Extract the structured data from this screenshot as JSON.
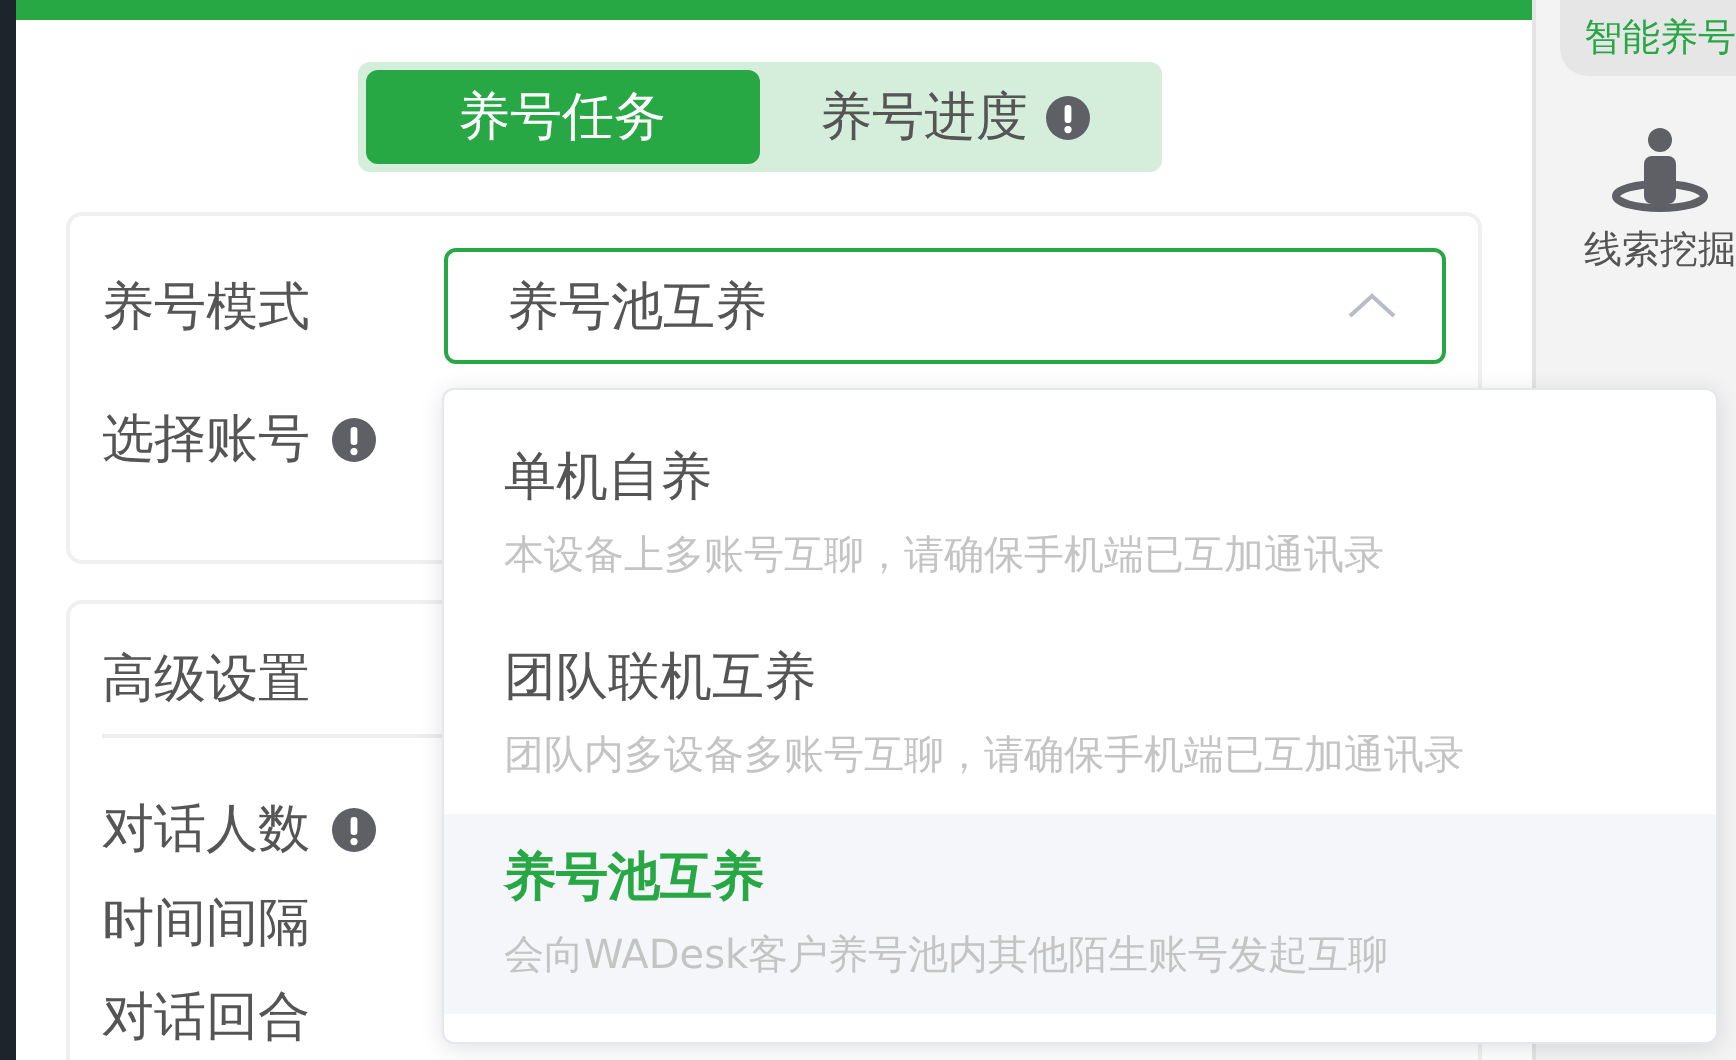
{
  "tabs": [
    {
      "label": "养号任务",
      "selected": true,
      "info": false
    },
    {
      "label": "养号进度",
      "selected": false,
      "info": true
    }
  ],
  "mode_field": {
    "label": "养号模式",
    "value": "养号池互养",
    "expanded": true
  },
  "account_field": {
    "label": "选择账号",
    "info": true
  },
  "dropdown": [
    {
      "title": "单机自养",
      "description": "本设备上多账号互聊，请确保手机端已互加通讯录",
      "selected": false
    },
    {
      "title": "团队联机互养",
      "description": "团队内多设备多账号互聊，请确保手机端已互加通讯录",
      "selected": false
    },
    {
      "title": "养号池互养",
      "description": "会向WADesk客户养号池内其他陌生账号发起互聊",
      "selected": true
    }
  ],
  "advanced": {
    "title": "高级设置",
    "rows": [
      {
        "label": "对话人数",
        "info": true
      },
      {
        "label": "时间间隔",
        "info": false
      },
      {
        "label": "对话回合",
        "info": false
      }
    ]
  },
  "sidebar": {
    "items": [
      {
        "label": "智能养号",
        "selected": true,
        "kind": "text"
      },
      {
        "label": "线索挖掘",
        "selected": false,
        "kind": "person"
      }
    ]
  }
}
